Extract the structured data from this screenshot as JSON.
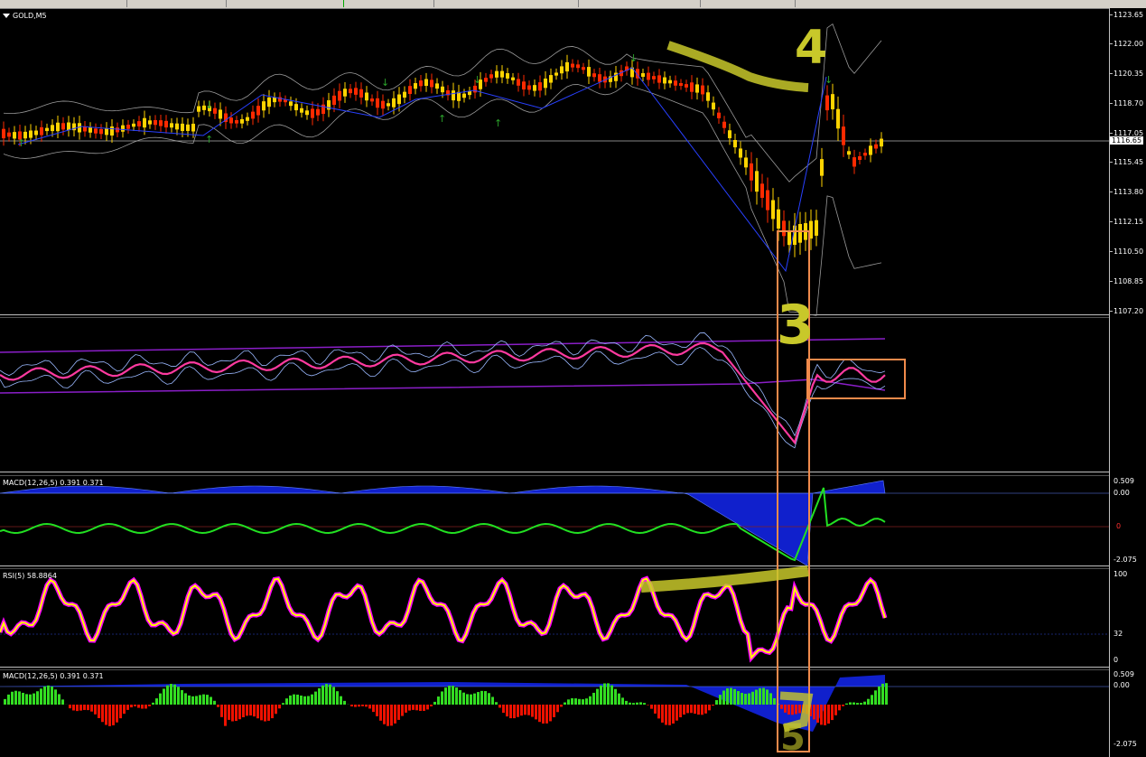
{
  "main_chart": {
    "symbol_label": "GOLD,M5",
    "current_price": "1116.65",
    "price_scale": [
      "1123.65",
      "1122.00",
      "1120.35",
      "1118.70",
      "1117.05",
      "1115.45",
      "1113.80",
      "1112.15",
      "1110.50",
      "1108.85",
      "1107.20"
    ]
  },
  "rsi_band_pane": {
    "label": ""
  },
  "macd_pane_1": {
    "label": "MACD(12,26,5) 0.391 0.371",
    "scale_top": "0.509",
    "scale_zero": "0.00",
    "scale_bottom": "-2.075",
    "marker": "0"
  },
  "rsi_pane": {
    "label": "RSI(5) 58.8864",
    "scale_top": "100",
    "scale_mid": "32",
    "scale_bottom": "0"
  },
  "macd_pane_2": {
    "label": "MACD(12,26,5) 0.391 0.371",
    "scale_top": "0.509",
    "scale_zero": "0.00",
    "scale_bottom": "-2.075"
  },
  "annotations": {
    "handwritten_marks": [
      "4",
      "3",
      "5"
    ],
    "highlight_color": "#c8c82a",
    "box_color": "#f08a4b"
  },
  "colors": {
    "bull_candle": "#ffd400",
    "bear_candle": "#ff2a00",
    "zigzag": "#2840ff",
    "rsi_main": "#ffff00",
    "rsi_glow": "#ff00ff",
    "macd_hist_pos": "#33dd22",
    "macd_hist_neg": "#ee1100",
    "macd_fill": "#1020cc"
  }
}
